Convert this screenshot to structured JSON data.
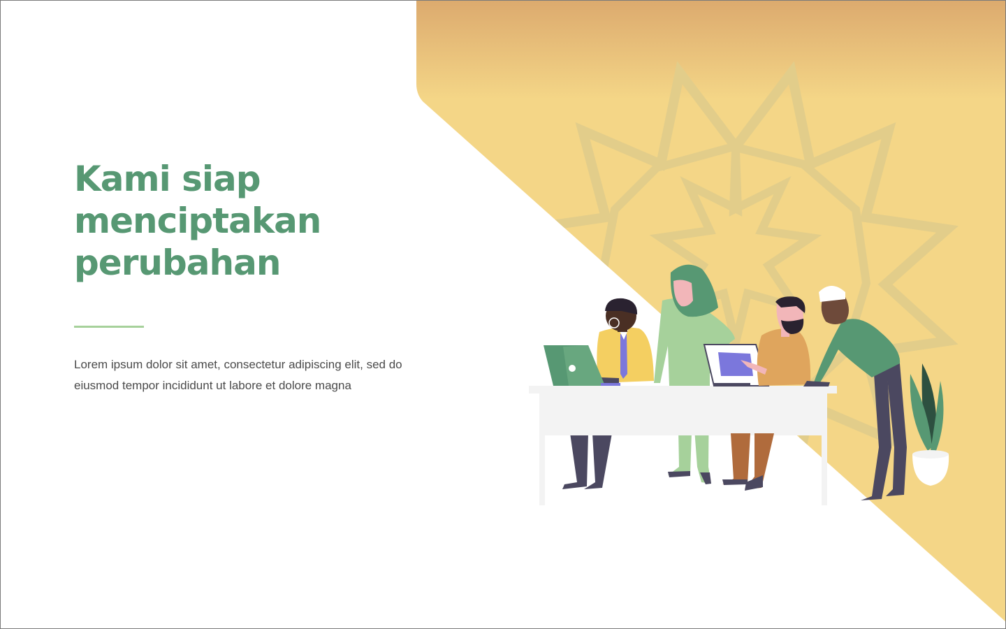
{
  "hero": {
    "title": "Kami siap\nmenciptakan\nperubahan",
    "body": "Lorem ipsum dolor sit amet, consectetur adipiscing elit, sed do eiusmod tempor incididunt ut labore et dolore magna"
  },
  "illustration": {
    "icons": [
      "star-ornament-icon",
      "laptop-icon",
      "monitor-icon",
      "plant-icon",
      "desk-icon"
    ],
    "colors": {
      "brand_green": "#579873",
      "accent_light_green": "#a6d19b",
      "gold_light": "#f4d687",
      "gold_dark": "#dcaa6e",
      "ornament": "#e2cd8a",
      "desk": "#f3f3f3",
      "screen_purple": "#7b77dc",
      "pants_dark": "#4b4860",
      "mustard_shirt": "#f4cf61",
      "tan_shirt": "#dfa55d"
    }
  }
}
